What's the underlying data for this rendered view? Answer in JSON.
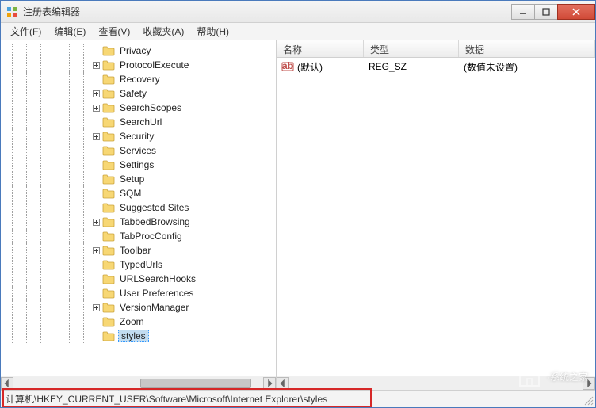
{
  "window": {
    "title": "注册表编辑器"
  },
  "menu": {
    "file": "文件(F)",
    "edit": "编辑(E)",
    "view": "查看(V)",
    "favorites": "收藏夹(A)",
    "help": "帮助(H)"
  },
  "tree": {
    "items": [
      {
        "label": "Privacy",
        "expandable": false
      },
      {
        "label": "ProtocolExecute",
        "expandable": true
      },
      {
        "label": "Recovery",
        "expandable": false
      },
      {
        "label": "Safety",
        "expandable": true
      },
      {
        "label": "SearchScopes",
        "expandable": true
      },
      {
        "label": "SearchUrl",
        "expandable": false
      },
      {
        "label": "Security",
        "expandable": true
      },
      {
        "label": "Services",
        "expandable": false
      },
      {
        "label": "Settings",
        "expandable": false
      },
      {
        "label": "Setup",
        "expandable": false
      },
      {
        "label": "SQM",
        "expandable": false
      },
      {
        "label": "Suggested Sites",
        "expandable": false
      },
      {
        "label": "TabbedBrowsing",
        "expandable": true
      },
      {
        "label": "TabProcConfig",
        "expandable": false
      },
      {
        "label": "Toolbar",
        "expandable": true
      },
      {
        "label": "TypedUrls",
        "expandable": false
      },
      {
        "label": "URLSearchHooks",
        "expandable": false
      },
      {
        "label": "User Preferences",
        "expandable": false
      },
      {
        "label": "VersionManager",
        "expandable": true
      },
      {
        "label": "Zoom",
        "expandable": false
      },
      {
        "label": "styles",
        "expandable": false,
        "selected": true
      }
    ]
  },
  "list": {
    "columns": {
      "name": "名称",
      "type": "类型",
      "data": "数据"
    },
    "rows": [
      {
        "name": "(默认)",
        "type": "REG_SZ",
        "data": "(数值未设置)"
      }
    ]
  },
  "status": {
    "path": "计算机\\HKEY_CURRENT_USER\\Software\\Microsoft\\Internet Explorer\\styles"
  },
  "watermark": {
    "text": "·系统之家"
  }
}
